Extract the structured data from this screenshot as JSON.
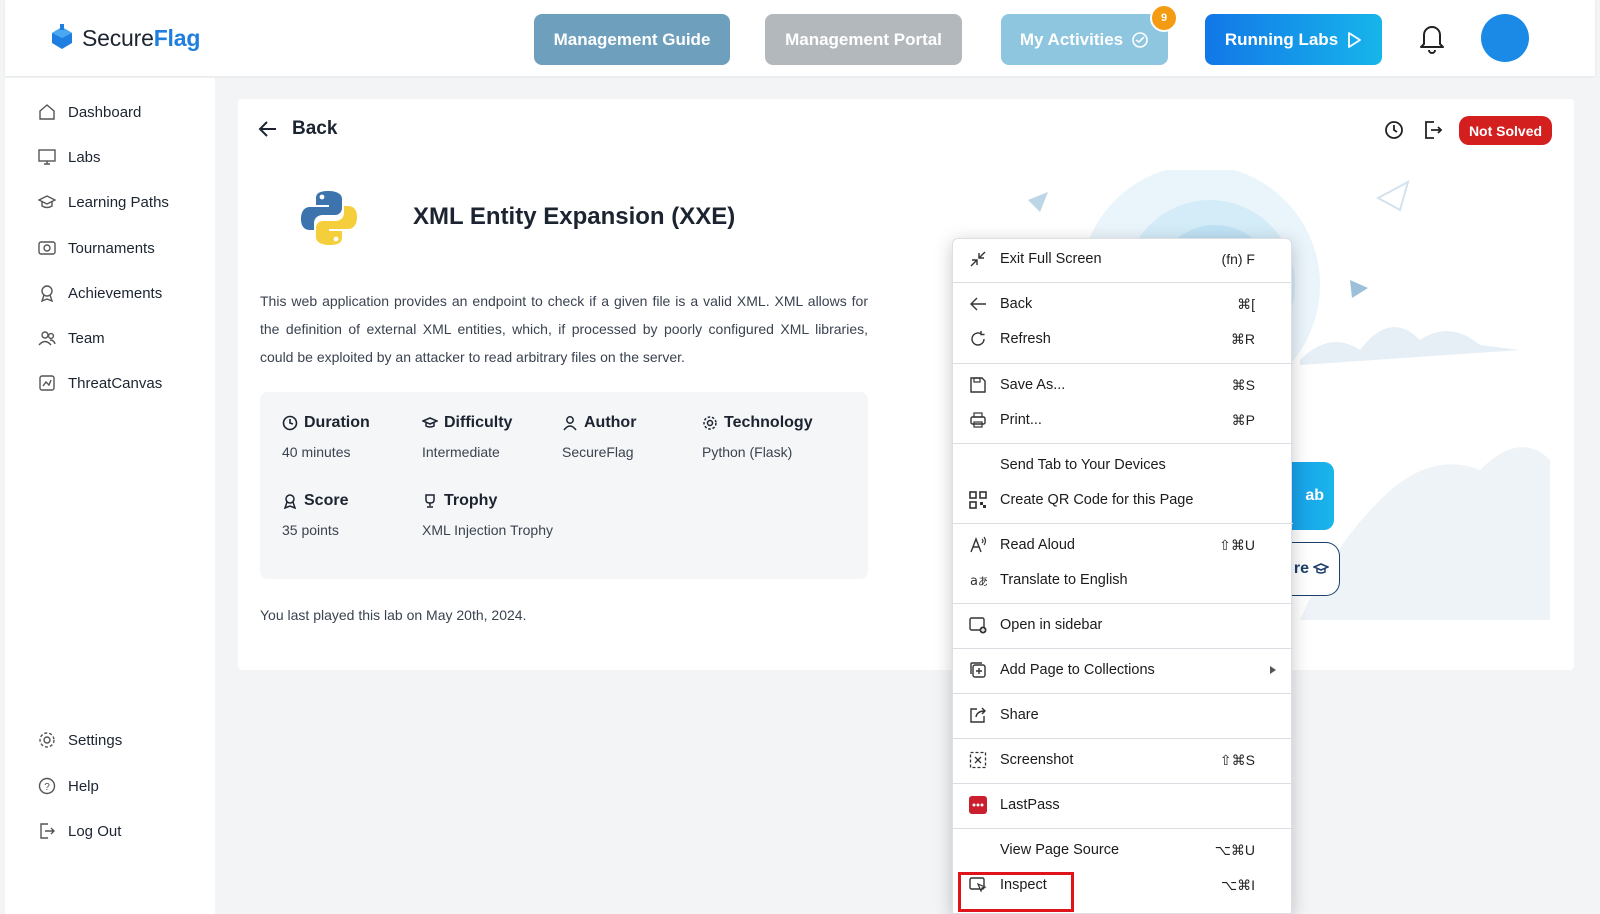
{
  "header": {
    "logo_text_a": "Secure",
    "logo_text_b": "Flag",
    "buttons": {
      "guide": "Management Guide",
      "portal": "Management Portal",
      "activities": "My Activities",
      "activities_badge": "9",
      "running": "Running Labs"
    }
  },
  "sidebar": {
    "items": [
      {
        "label": "Dashboard",
        "icon": "home-icon"
      },
      {
        "label": "Labs",
        "icon": "monitor-icon"
      },
      {
        "label": "Learning Paths",
        "icon": "graduation-cap-icon"
      },
      {
        "label": "Tournaments",
        "icon": "tournament-icon"
      },
      {
        "label": "Achievements",
        "icon": "award-icon"
      },
      {
        "label": "Team",
        "icon": "team-icon"
      },
      {
        "label": "ThreatCanvas",
        "icon": "canvas-icon"
      }
    ],
    "bottom": [
      {
        "label": "Settings",
        "icon": "gear-icon"
      },
      {
        "label": "Help",
        "icon": "help-icon"
      },
      {
        "label": "Log Out",
        "icon": "logout-icon"
      }
    ]
  },
  "lab": {
    "back_label": "Back",
    "status": "Not Solved",
    "title": "XML Entity Expansion (XXE)",
    "description": "This web application provides an endpoint to check if a given file is a valid XML. XML allows for the definition of external XML entities, which, if processed by poorly configured XML libraries, could be exploited by an attacker to read arbitrary files on the server.",
    "info": {
      "duration": {
        "label": "Duration",
        "value": "40 minutes"
      },
      "difficulty": {
        "label": "Difficulty",
        "value": "Intermediate"
      },
      "author": {
        "label": "Author",
        "value": "SecureFlag"
      },
      "technology": {
        "label": "Technology",
        "value": "Python (Flask)"
      },
      "score": {
        "label": "Score",
        "value": "35 points"
      },
      "trophy": {
        "label": "Trophy",
        "value": "XML Injection Trophy"
      }
    },
    "last_played": "You last played this lab on May 20th, 2024.",
    "start_partial": "ab",
    "explore_partial": "re"
  },
  "context_menu": {
    "items": [
      {
        "label": "Exit Full Screen",
        "shortcut": "(fn) F",
        "icon": "exit-fullscreen-icon"
      },
      {
        "label": "Back",
        "shortcut": "⌘[",
        "icon": "arrow-left-icon"
      },
      {
        "label": "Refresh",
        "shortcut": "⌘R",
        "icon": "refresh-icon"
      },
      {
        "label": "Save As...",
        "shortcut": "⌘S",
        "icon": "save-icon"
      },
      {
        "label": "Print...",
        "shortcut": "⌘P",
        "icon": "printer-icon"
      },
      {
        "label": "Send Tab to Your Devices",
        "shortcut": "",
        "icon": ""
      },
      {
        "label": "Create QR Code for this Page",
        "shortcut": "",
        "icon": "qr-code-icon"
      },
      {
        "label": "Read Aloud",
        "shortcut": "⇧⌘U",
        "icon": "read-aloud-icon"
      },
      {
        "label": "Translate to English",
        "shortcut": "",
        "icon": "translate-icon"
      },
      {
        "label": "Open in sidebar",
        "shortcut": "",
        "icon": "sidebar-icon"
      },
      {
        "label": "Add Page to Collections",
        "shortcut": "",
        "icon": "collections-icon"
      },
      {
        "label": "Share",
        "shortcut": "",
        "icon": "share-icon"
      },
      {
        "label": "Screenshot",
        "shortcut": "⇧⌘S",
        "icon": "screenshot-icon"
      },
      {
        "label": "LastPass",
        "shortcut": "",
        "icon": "lastpass-icon"
      },
      {
        "label": "View Page Source",
        "shortcut": "⌥⌘U",
        "icon": ""
      },
      {
        "label": "Inspect",
        "shortcut": "⌥⌘I",
        "icon": "inspect-icon"
      }
    ]
  },
  "colors": {
    "brand_blue": "#1f7fe0",
    "not_solved_red": "#d41f1f",
    "highlight_red": "#e0121b"
  }
}
